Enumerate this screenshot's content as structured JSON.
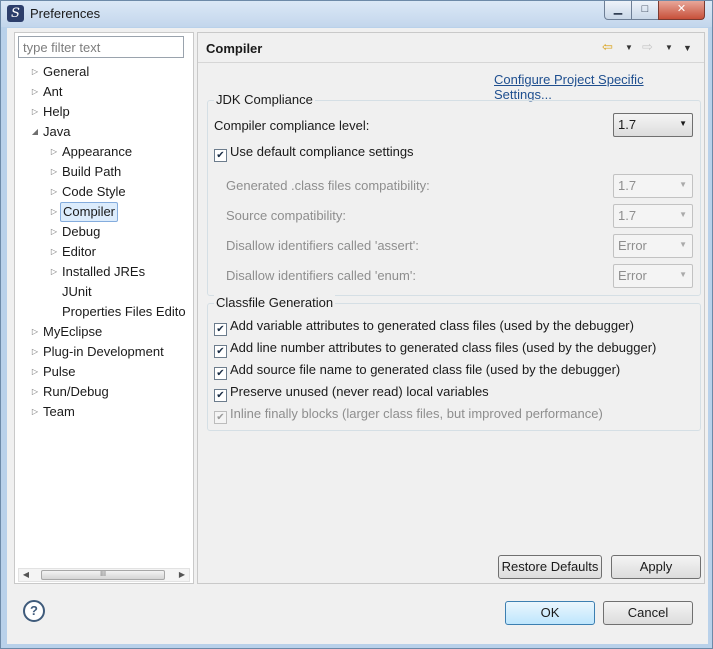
{
  "window": {
    "title": "Preferences",
    "icon_letter": "S",
    "minimize": "▁",
    "maximize": "□",
    "close": "✕"
  },
  "filter": {
    "placeholder": "type filter text"
  },
  "tree": [
    {
      "label": "General",
      "level": 0,
      "expandable": true,
      "expanded": false
    },
    {
      "label": "Ant",
      "level": 0,
      "expandable": true,
      "expanded": false
    },
    {
      "label": "Help",
      "level": 0,
      "expandable": true,
      "expanded": false
    },
    {
      "label": "Java",
      "level": 0,
      "expandable": true,
      "expanded": true
    },
    {
      "label": "Appearance",
      "level": 1,
      "expandable": true,
      "expanded": false
    },
    {
      "label": "Build Path",
      "level": 1,
      "expandable": true,
      "expanded": false
    },
    {
      "label": "Code Style",
      "level": 1,
      "expandable": true,
      "expanded": false
    },
    {
      "label": "Compiler",
      "level": 1,
      "expandable": true,
      "expanded": false,
      "selected": true
    },
    {
      "label": "Debug",
      "level": 1,
      "expandable": true,
      "expanded": false
    },
    {
      "label": "Editor",
      "level": 1,
      "expandable": true,
      "expanded": false
    },
    {
      "label": "Installed JREs",
      "level": 1,
      "expandable": true,
      "expanded": false
    },
    {
      "label": "JUnit",
      "level": 1,
      "expandable": false
    },
    {
      "label": "Properties Files Edito",
      "level": 1,
      "expandable": false
    },
    {
      "label": "MyEclipse",
      "level": 0,
      "expandable": true,
      "expanded": false
    },
    {
      "label": "Plug-in Development",
      "level": 0,
      "expandable": true,
      "expanded": false
    },
    {
      "label": "Pulse",
      "level": 0,
      "expandable": true,
      "expanded": false
    },
    {
      "label": "Run/Debug",
      "level": 0,
      "expandable": true,
      "expanded": false
    },
    {
      "label": "Team",
      "level": 0,
      "expandable": true,
      "expanded": false
    }
  ],
  "scrollbar": {
    "thumb_grip": "III",
    "left_arrow": "◀",
    "right_arrow": "▶"
  },
  "page": {
    "title": "Compiler",
    "nav_back": "⇦",
    "nav_forward": "⇨",
    "dropdown": "▼",
    "config_link": "Configure Project Specific Settings..."
  },
  "jdk": {
    "group_title": "JDK Compliance",
    "compliance_label": "Compiler compliance level:",
    "compliance_value": "1.7",
    "use_default_label": "Use default compliance settings",
    "use_default_checked": true,
    "rows": [
      {
        "label": "Generated .class files compatibility:",
        "value": "1.7"
      },
      {
        "label": "Source compatibility:",
        "value": "1.7"
      },
      {
        "label": "Disallow identifiers called 'assert':",
        "value": "Error"
      },
      {
        "label": "Disallow identifiers called 'enum':",
        "value": "Error"
      }
    ]
  },
  "classfile": {
    "group_title": "Classfile Generation",
    "options": [
      {
        "label": "Add variable attributes to generated class files (used by the debugger)",
        "checked": true,
        "enabled": true
      },
      {
        "label": "Add line number attributes to generated class files (used by the debugger)",
        "checked": true,
        "enabled": true
      },
      {
        "label": "Add source file name to generated class file (used by the debugger)",
        "checked": true,
        "enabled": true
      },
      {
        "label": "Preserve unused (never read) local variables",
        "checked": true,
        "enabled": true
      },
      {
        "label": "Inline finally blocks (larger class files, but improved performance)",
        "checked": true,
        "enabled": false
      }
    ]
  },
  "buttons": {
    "restore_defaults": "Restore Defaults",
    "apply": "Apply",
    "help": "?",
    "ok": "OK",
    "cancel": "Cancel"
  }
}
